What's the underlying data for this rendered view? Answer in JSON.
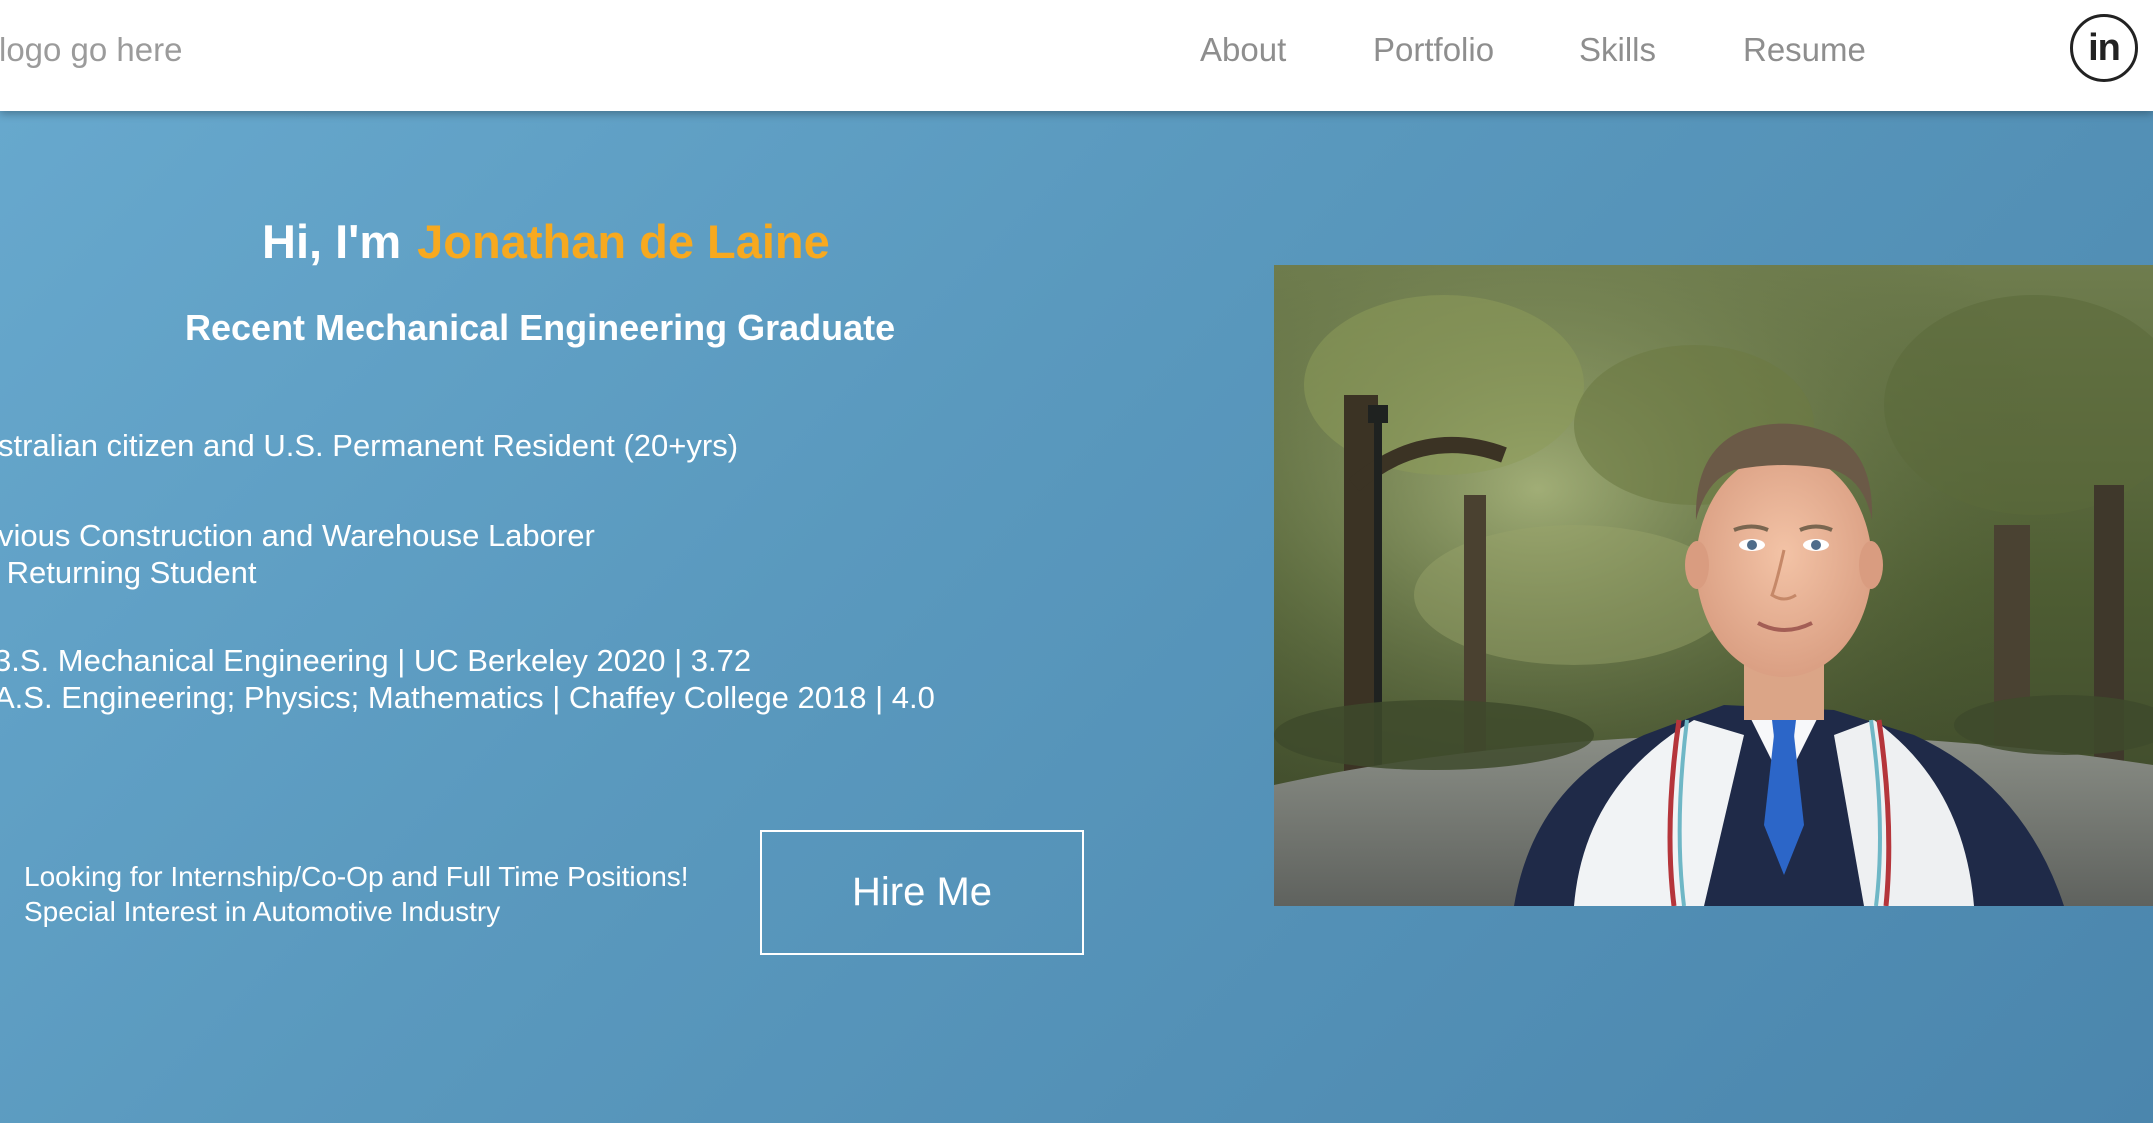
{
  "header": {
    "logo_text": "logo go here",
    "nav": [
      {
        "label": "About"
      },
      {
        "label": "Portfolio"
      },
      {
        "label": "Skills"
      },
      {
        "label": "Resume"
      }
    ],
    "linkedin_icon": "linkedin-icon",
    "linkedin_text": "in"
  },
  "hero": {
    "greeting_prefix": "Hi, I'm",
    "name": "Jonathan de Laine",
    "subtitle": "Recent Mechanical Engineering Graduate",
    "lines": [
      "stralian citizen and U.S. Permanent Resident (20+yrs)",
      "vious Construction and Warehouse Laborer",
      " Returning Student",
      "3.S. Mechanical Engineering | UC Berkeley 2020 | 3.72",
      "A.S. Engineering; Physics; Mathematics | Chaffey College 2018 | 4.0"
    ],
    "cta_lines": [
      "Looking for Internship/Co-Op and Full Time Positions!",
      "Special Interest in Automotive Industry"
    ],
    "hire_button": "Hire Me",
    "photo_icon": "graduate-portrait-photo"
  },
  "colors": {
    "accent_name": "#f7a91f",
    "hero_bg_start": "#67a8cd",
    "hero_bg_end": "#4b86ad",
    "nav_text": "#8e8e8e"
  }
}
